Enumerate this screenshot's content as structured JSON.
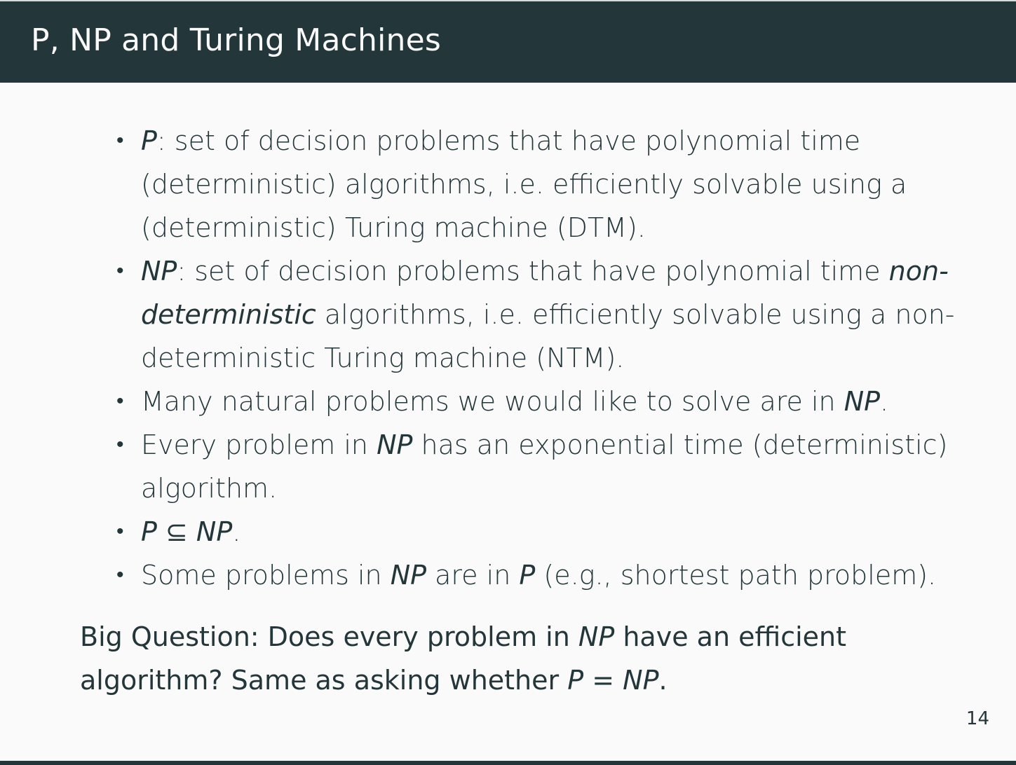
{
  "slide": {
    "title": "P, NP and Turing Machines",
    "page_number": "14"
  },
  "bullets": [
    {
      "parts": [
        {
          "text": "P",
          "italic": true
        },
        {
          "text": ": set of decision problems that have polynomial time (deterministic) algorithms, i.e. efficiently solvable using a (deterministic) Turing machine (DTM).",
          "italic": false
        }
      ]
    },
    {
      "parts": [
        {
          "text": "NP",
          "italic": true
        },
        {
          "text": ": set of decision problems that have polynomial time ",
          "italic": false
        },
        {
          "text": "non-deterministic",
          "italic": true
        },
        {
          "text": " algorithms, i.e. efficiently solvable using a non-deterministic Turing machine (NTM).",
          "italic": false
        }
      ]
    },
    {
      "parts": [
        {
          "text": "Many natural problems we would like to solve are in ",
          "italic": false
        },
        {
          "text": "NP",
          "italic": true
        },
        {
          "text": ".",
          "italic": false
        }
      ]
    },
    {
      "parts": [
        {
          "text": "Every problem in ",
          "italic": false
        },
        {
          "text": "NP",
          "italic": true
        },
        {
          "text": " has an exponential time (deterministic) algorithm.",
          "italic": false
        }
      ]
    },
    {
      "parts": [
        {
          "text": "P",
          "italic": true
        },
        {
          "text": " ⊆ ",
          "italic": false
        },
        {
          "text": "NP",
          "italic": true
        },
        {
          "text": ".",
          "italic": false
        }
      ]
    },
    {
      "parts": [
        {
          "text": "Some problems in ",
          "italic": false
        },
        {
          "text": "NP",
          "italic": true
        },
        {
          "text": " are in ",
          "italic": false
        },
        {
          "text": "P",
          "italic": true
        },
        {
          "text": " (e.g., shortest path problem).",
          "italic": false
        }
      ]
    }
  ],
  "big_question": {
    "label": "Big Question:",
    "parts": [
      {
        "text": " Does every problem in ",
        "italic": false
      },
      {
        "text": "NP",
        "italic": true
      },
      {
        "text": " have an efficient algorithm? Same as asking whether ",
        "italic": false
      },
      {
        "text": "P",
        "italic": true
      },
      {
        "text": " = ",
        "italic": false
      },
      {
        "text": "NP",
        "italic": true
      },
      {
        "text": ".",
        "italic": false
      }
    ]
  },
  "colors": {
    "header_bg": "#23373b",
    "header_text": "#fafafa",
    "body_bg": "#fafafa",
    "body_text": "#23373b"
  }
}
